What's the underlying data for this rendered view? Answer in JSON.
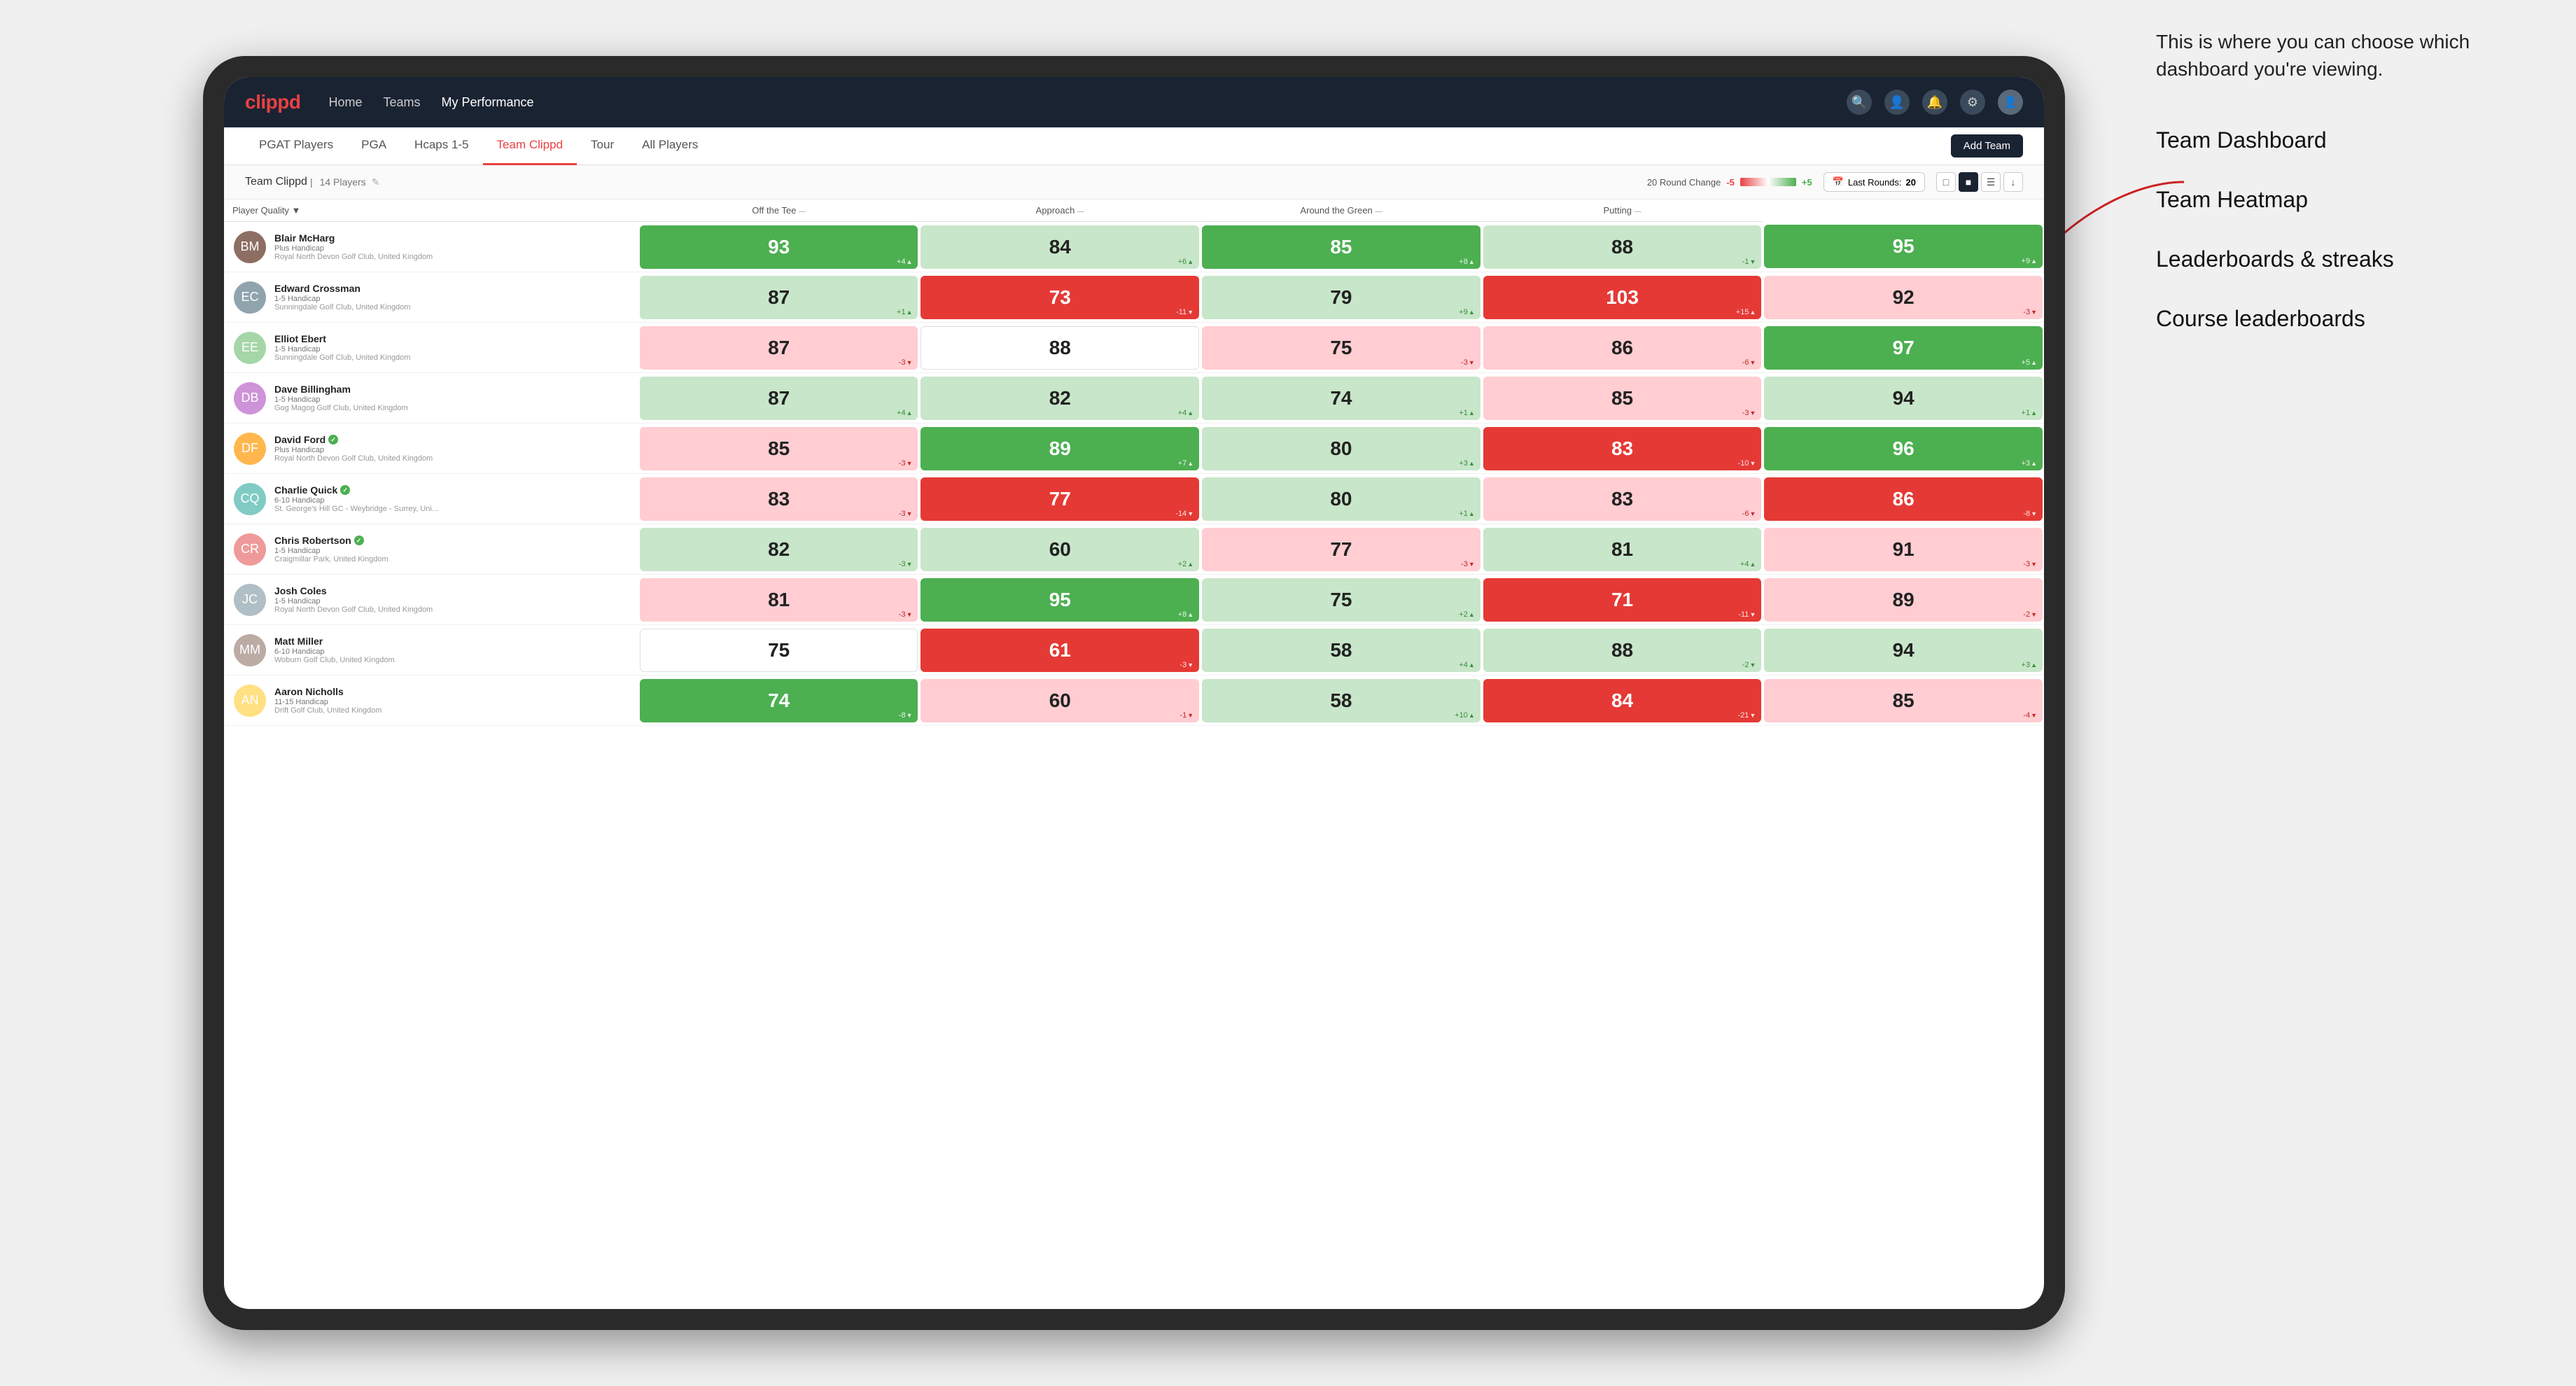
{
  "annotation": {
    "intro": "This is where you can choose which dashboard you're viewing.",
    "items": [
      "Team Dashboard",
      "Team Heatmap",
      "Leaderboards & streaks",
      "Course leaderboards"
    ]
  },
  "navbar": {
    "logo": "clippd",
    "nav_items": [
      "Home",
      "Teams",
      "My Performance"
    ],
    "active_nav": "My Performance"
  },
  "subnav": {
    "items": [
      "PGAT Players",
      "PGA",
      "Hcaps 1-5",
      "Team Clippd",
      "Tour",
      "All Players"
    ],
    "active": "Team Clippd",
    "add_team_label": "Add Team"
  },
  "team_header": {
    "team_name": "Team Clippd",
    "player_count": "14 Players",
    "round_change_label": "20 Round Change",
    "range_low": "-5",
    "range_high": "+5",
    "last_rounds_label": "Last Rounds:",
    "last_rounds_value": "20"
  },
  "table": {
    "columns": [
      {
        "id": "player",
        "label": "Player Quality",
        "sortable": true
      },
      {
        "id": "off_tee",
        "label": "Off the Tee",
        "sortable": true
      },
      {
        "id": "approach",
        "label": "Approach",
        "sortable": true
      },
      {
        "id": "around_green",
        "label": "Around the Green",
        "sortable": true
      },
      {
        "id": "putting",
        "label": "Putting",
        "sortable": true
      }
    ],
    "rows": [
      {
        "name": "Blair McHarg",
        "handicap": "Plus Handicap",
        "club": "Royal North Devon Golf Club, United Kingdom",
        "verified": false,
        "off_tee": {
          "value": 93,
          "change": "+4",
          "dir": "up",
          "color": "green"
        },
        "approach": {
          "value": 84,
          "change": "+6",
          "dir": "up",
          "color": "green-light"
        },
        "around_green": {
          "value": 85,
          "change": "+8",
          "dir": "up",
          "color": "green"
        },
        "around_the_green": {
          "value": 88,
          "change": "-1",
          "dir": "down",
          "color": "green-light"
        },
        "putting": {
          "value": 95,
          "change": "+9",
          "dir": "up",
          "color": "green"
        }
      },
      {
        "name": "Edward Crossman",
        "handicap": "1-5 Handicap",
        "club": "Sunningdale Golf Club, United Kingdom",
        "verified": false,
        "off_tee": {
          "value": 87,
          "change": "+1",
          "dir": "up",
          "color": "green-light"
        },
        "approach": {
          "value": 73,
          "change": "-11",
          "dir": "down",
          "color": "red"
        },
        "around_green": {
          "value": 79,
          "change": "+9",
          "dir": "up",
          "color": "green-light"
        },
        "around_the_green": {
          "value": 103,
          "change": "+15",
          "dir": "up",
          "color": "red"
        },
        "putting": {
          "value": 92,
          "change": "-3",
          "dir": "down",
          "color": "red-light"
        }
      },
      {
        "name": "Elliot Ebert",
        "handicap": "1-5 Handicap",
        "club": "Sunningdale Golf Club, United Kingdom",
        "verified": false,
        "off_tee": {
          "value": 87,
          "change": "-3",
          "dir": "down",
          "color": "red-light"
        },
        "approach": {
          "value": 88,
          "change": "",
          "dir": "",
          "color": "neutral"
        },
        "around_green": {
          "value": 75,
          "change": "-3",
          "dir": "down",
          "color": "red-light"
        },
        "around_the_green": {
          "value": 86,
          "change": "-6",
          "dir": "down",
          "color": "red-light"
        },
        "putting": {
          "value": 97,
          "change": "+5",
          "dir": "up",
          "color": "green"
        }
      },
      {
        "name": "Dave Billingham",
        "handicap": "1-5 Handicap",
        "club": "Gog Magog Golf Club, United Kingdom",
        "verified": false,
        "off_tee": {
          "value": 87,
          "change": "+4",
          "dir": "up",
          "color": "green-light"
        },
        "approach": {
          "value": 82,
          "change": "+4",
          "dir": "up",
          "color": "green-light"
        },
        "around_green": {
          "value": 74,
          "change": "+1",
          "dir": "up",
          "color": "green-light"
        },
        "around_the_green": {
          "value": 85,
          "change": "-3",
          "dir": "down",
          "color": "red-light"
        },
        "putting": {
          "value": 94,
          "change": "+1",
          "dir": "up",
          "color": "green-light"
        }
      },
      {
        "name": "David Ford",
        "handicap": "Plus Handicap",
        "club": "Royal North Devon Golf Club, United Kingdom",
        "verified": true,
        "off_tee": {
          "value": 85,
          "change": "-3",
          "dir": "down",
          "color": "red-light"
        },
        "approach": {
          "value": 89,
          "change": "+7",
          "dir": "up",
          "color": "green"
        },
        "around_green": {
          "value": 80,
          "change": "+3",
          "dir": "up",
          "color": "green-light"
        },
        "around_the_green": {
          "value": 83,
          "change": "-10",
          "dir": "down",
          "color": "red"
        },
        "putting": {
          "value": 96,
          "change": "+3",
          "dir": "up",
          "color": "green"
        }
      },
      {
        "name": "Charlie Quick",
        "handicap": "6-10 Handicap",
        "club": "St. George's Hill GC - Weybridge - Surrey, Uni...",
        "verified": true,
        "off_tee": {
          "value": 83,
          "change": "-3",
          "dir": "down",
          "color": "red-light"
        },
        "approach": {
          "value": 77,
          "change": "-14",
          "dir": "down",
          "color": "red"
        },
        "around_green": {
          "value": 80,
          "change": "+1",
          "dir": "up",
          "color": "green-light"
        },
        "around_the_green": {
          "value": 83,
          "change": "-6",
          "dir": "down",
          "color": "red-light"
        },
        "putting": {
          "value": 86,
          "change": "-8",
          "dir": "down",
          "color": "red"
        }
      },
      {
        "name": "Chris Robertson",
        "handicap": "1-5 Handicap",
        "club": "Craigmillar Park, United Kingdom",
        "verified": true,
        "off_tee": {
          "value": 82,
          "change": "-3",
          "dir": "down",
          "color": "green-light"
        },
        "approach": {
          "value": 60,
          "change": "+2",
          "dir": "up",
          "color": "green-light"
        },
        "around_green": {
          "value": 77,
          "change": "-3",
          "dir": "down",
          "color": "red-light"
        },
        "around_the_green": {
          "value": 81,
          "change": "+4",
          "dir": "up",
          "color": "green-light"
        },
        "putting": {
          "value": 91,
          "change": "-3",
          "dir": "down",
          "color": "red-light"
        }
      },
      {
        "name": "Josh Coles",
        "handicap": "1-5 Handicap",
        "club": "Royal North Devon Golf Club, United Kingdom",
        "verified": false,
        "off_tee": {
          "value": 81,
          "change": "-3",
          "dir": "down",
          "color": "red-light"
        },
        "approach": {
          "value": 95,
          "change": "+8",
          "dir": "up",
          "color": "green"
        },
        "around_green": {
          "value": 75,
          "change": "+2",
          "dir": "up",
          "color": "green-light"
        },
        "around_the_green": {
          "value": 71,
          "change": "-11",
          "dir": "down",
          "color": "red"
        },
        "putting": {
          "value": 89,
          "change": "-2",
          "dir": "down",
          "color": "red-light"
        }
      },
      {
        "name": "Matt Miller",
        "handicap": "6-10 Handicap",
        "club": "Woburn Golf Club, United Kingdom",
        "verified": false,
        "off_tee": {
          "value": 75,
          "change": "",
          "dir": "",
          "color": "neutral"
        },
        "approach": {
          "value": 61,
          "change": "-3",
          "dir": "down",
          "color": "red"
        },
        "around_green": {
          "value": 58,
          "change": "+4",
          "dir": "up",
          "color": "green-light"
        },
        "around_the_green": {
          "value": 88,
          "change": "-2",
          "dir": "down",
          "color": "green-light"
        },
        "putting": {
          "value": 94,
          "change": "+3",
          "dir": "up",
          "color": "green-light"
        }
      },
      {
        "name": "Aaron Nicholls",
        "handicap": "11-15 Handicap",
        "club": "Drift Golf Club, United Kingdom",
        "verified": false,
        "off_tee": {
          "value": 74,
          "change": "-8",
          "dir": "down",
          "color": "green"
        },
        "approach": {
          "value": 60,
          "change": "-1",
          "dir": "down",
          "color": "red-light"
        },
        "around_green": {
          "value": 58,
          "change": "+10",
          "dir": "up",
          "color": "green-light"
        },
        "around_the_green": {
          "value": 84,
          "change": "-21",
          "dir": "down",
          "color": "red"
        },
        "putting": {
          "value": 85,
          "change": "-4",
          "dir": "down",
          "color": "red-light"
        }
      }
    ]
  }
}
